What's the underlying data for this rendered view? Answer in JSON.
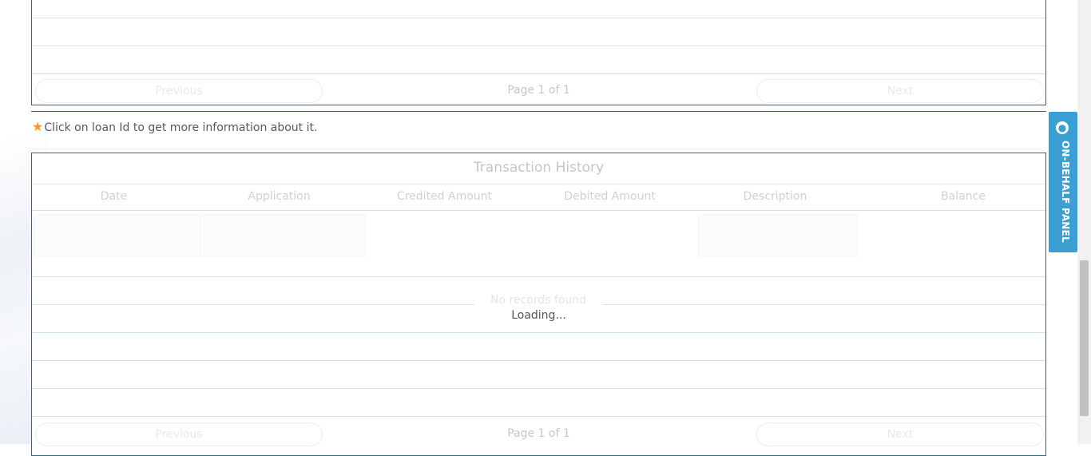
{
  "top_table": {
    "pagination": {
      "previous_label": "Previous",
      "page_info": "Page 1 of 1",
      "next_label": "Next"
    }
  },
  "note": {
    "star_icon": "★",
    "text": "Click on loan Id to get more information about it."
  },
  "transaction_history": {
    "title": "Transaction History",
    "columns": [
      "Date",
      "Application",
      "Credited Amount",
      "Debited Amount",
      "Description",
      "Balance"
    ],
    "no_records_text": "No records found",
    "loading_text": "Loading...",
    "pagination": {
      "previous_label": "Previous",
      "page_info": "Page 1 of 1",
      "next_label": "Next"
    }
  },
  "side_panel": {
    "icon": "user-circle-icon",
    "label": "ON-BEHALF PANEL",
    "color": "#3b9fd1"
  }
}
